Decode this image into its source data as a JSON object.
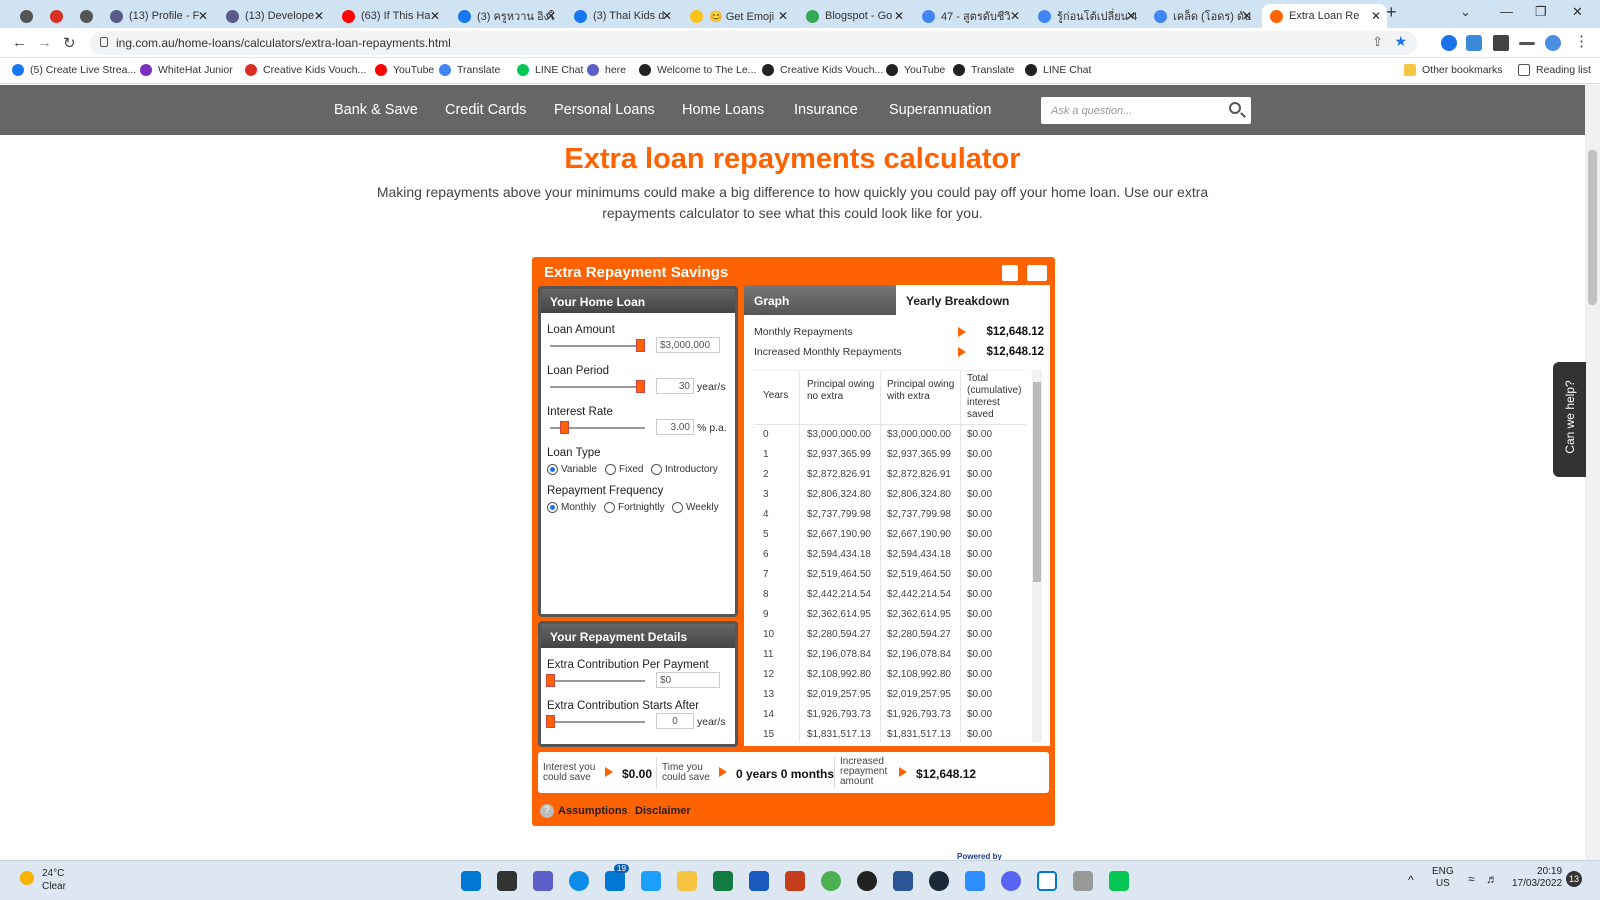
{
  "browser": {
    "tabs": [
      {
        "label": "",
        "color": "#555"
      },
      {
        "label": "",
        "color": "#d93025"
      },
      {
        "label": "",
        "color": "#555"
      },
      {
        "label": "(13) Profile - F",
        "color": "#5a5a8a"
      },
      {
        "label": "(13) Develope",
        "color": "#5a5a8a"
      },
      {
        "label": "(63) If This Ha",
        "color": "#ff0000"
      },
      {
        "label": "(3) ครูหวาน อิงใ",
        "color": "#1877f2"
      },
      {
        "label": "(3) Thai Kids d",
        "color": "#1877f2"
      },
      {
        "label": "😊 Get Emoji",
        "color": "#f9c31c"
      },
      {
        "label": "Blogspot - Go",
        "color": "#34a853"
      },
      {
        "label": "47 - สูตรดับชีวิ",
        "color": "#4285f4"
      },
      {
        "label": "รู้ก่อนโต้เปลี่ยน 4",
        "color": "#4285f4"
      },
      {
        "label": "เคล็ด (โอดร) ดับ",
        "color": "#4285f4"
      },
      {
        "label": "Extra Loan Re",
        "color": "#ff6200"
      }
    ],
    "url": "ing.com.au/home-loans/calculators/extra-loan-repayments.html",
    "bookmarks": [
      "(5) Create Live Strea...",
      "WhiteHat Junior",
      "Creative Kids Vouch...",
      "YouTube",
      "Translate",
      "LINE Chat",
      "here",
      "Welcome to The Le...",
      "Creative Kids Vouch...",
      "YouTube",
      "Translate",
      "LINE Chat"
    ],
    "other_bookmarks": "Other bookmarks",
    "reading_list": "Reading list"
  },
  "site_nav": {
    "items": [
      "Bank & Save",
      "Credit Cards",
      "Personal Loans",
      "Home Loans",
      "Insurance",
      "Superannuation"
    ],
    "search_placeholder": "Ask a question..."
  },
  "page": {
    "title": "Extra loan repayments calculator",
    "intro": "Making repayments above your minimums could make a big difference to how quickly you could pay off your home loan. Use our extra repayments calculator to see what this could look like for you."
  },
  "calculator": {
    "header": "Extra Repayment Savings",
    "home_loan_title": "Your Home Loan",
    "loan_amount_label": "Loan Amount",
    "loan_amount_value": "$3,000,000",
    "loan_amount_level": 1.0,
    "loan_period_label": "Loan Period",
    "loan_period_value": "30",
    "loan_period_level": 1.0,
    "period_unit": "year/s",
    "interest_rate_label": "Interest Rate",
    "interest_rate_value": "3.00",
    "interest_rate_level": 0.15,
    "rate_unit": "% p.a.",
    "loan_type_label": "Loan Type",
    "loan_types": [
      "Variable",
      "Fixed",
      "Introductory"
    ],
    "loan_type_selected": "Variable",
    "freq_label": "Repayment Frequency",
    "freqs": [
      "Monthly",
      "Fortnightly",
      "Weekly"
    ],
    "freq_selected": "Monthly",
    "repayment_title": "Your Repayment Details",
    "extra_contribution_label": "Extra Contribution Per Payment",
    "extra_contribution_value": "$0",
    "extra_contribution_level": 0.0,
    "extra_starts_label": "Extra Contribution Starts After",
    "extra_starts_value": "0",
    "extra_starts_level": 0.0,
    "tab_graph": "Graph",
    "tab_yearly": "Yearly Breakdown",
    "monthly_repayments_label": "Monthly Repayments",
    "monthly_repayments_value": "$12,648.12",
    "increased_monthly_label": "Increased Monthly Repayments",
    "increased_monthly_value": "$12,648.12",
    "table_headers": [
      "Years",
      "Principal owing no extra",
      "Principal owing with extra",
      "Total (cumulative) interest saved"
    ],
    "rows": [
      [
        "0",
        "$3,000,000.00",
        "$3,000,000.00",
        "$0.00"
      ],
      [
        "1",
        "$2,937,365.99",
        "$2,937,365.99",
        "$0.00"
      ],
      [
        "2",
        "$2,872,826.91",
        "$2,872,826.91",
        "$0.00"
      ],
      [
        "3",
        "$2,806,324.80",
        "$2,806,324.80",
        "$0.00"
      ],
      [
        "4",
        "$2,737,799.98",
        "$2,737,799.98",
        "$0.00"
      ],
      [
        "5",
        "$2,667,190.90",
        "$2,667,190.90",
        "$0.00"
      ],
      [
        "6",
        "$2,594,434.18",
        "$2,594,434.18",
        "$0.00"
      ],
      [
        "7",
        "$2,519,464.50",
        "$2,519,464.50",
        "$0.00"
      ],
      [
        "8",
        "$2,442,214.54",
        "$2,442,214.54",
        "$0.00"
      ],
      [
        "9",
        "$2,362,614.95",
        "$2,362,614.95",
        "$0.00"
      ],
      [
        "10",
        "$2,280,594.27",
        "$2,280,594.27",
        "$0.00"
      ],
      [
        "11",
        "$2,196,078.84",
        "$2,196,078.84",
        "$0.00"
      ],
      [
        "12",
        "$2,108,992.80",
        "$2,108,992.80",
        "$0.00"
      ],
      [
        "13",
        "$2,019,257.95",
        "$2,019,257.95",
        "$0.00"
      ],
      [
        "14",
        "$1,926,793.73",
        "$1,926,793.73",
        "$0.00"
      ],
      [
        "15",
        "$1,831,517.13",
        "$1,831,517.13",
        "$0.00"
      ]
    ],
    "interest_save_label": "Interest you could save",
    "interest_save_value": "$0.00",
    "time_save_label": "Time you could save",
    "time_save_value": "0 years 0 months",
    "increased_amount_label": "Increased repayment amount",
    "increased_amount_value": "$12,648.12",
    "assumptions": "Assumptions",
    "disclaimer": "Disclaimer",
    "powered_by": "Powered by"
  },
  "help_tab": "Can we help?",
  "taskbar": {
    "weather_temp": "24°C",
    "weather_desc": "Clear",
    "mail_badge": "19",
    "lang": "ENG",
    "region": "US",
    "time": "20:19",
    "date": "17/03/2022",
    "notif": "13"
  },
  "colors": {
    "brand": "#ff6200",
    "nav_bg": "#666666"
  }
}
